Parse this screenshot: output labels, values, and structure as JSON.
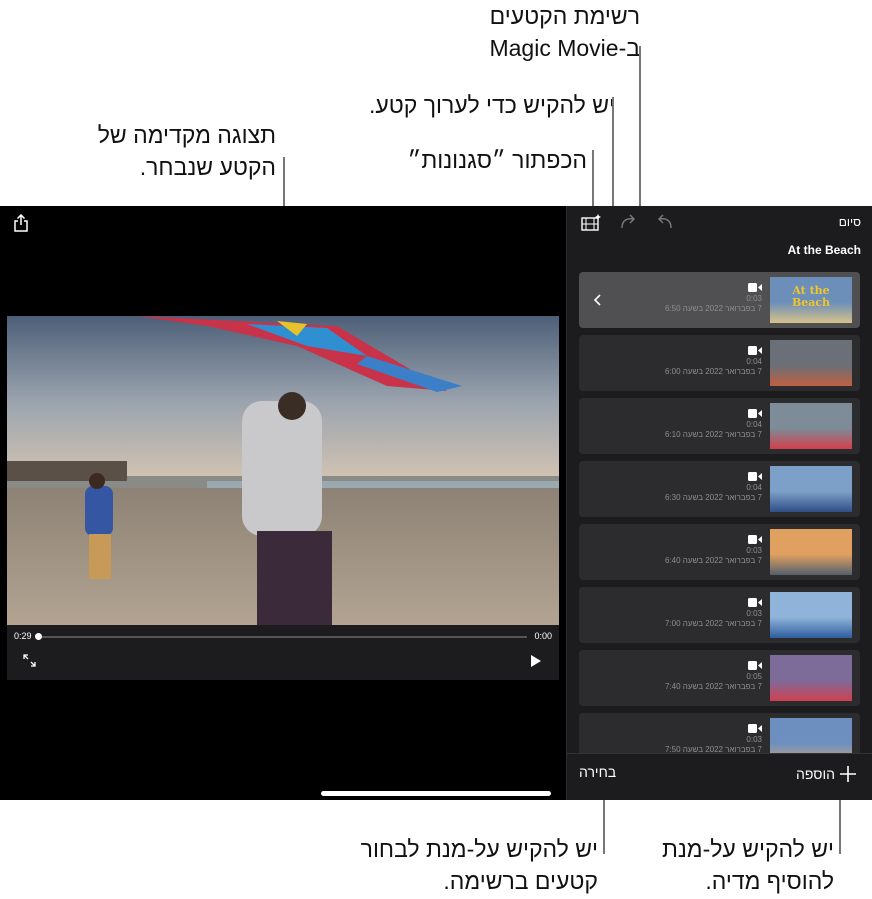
{
  "callouts": {
    "clip_list": [
      "רשימת הקטעים",
      "ב-Magic Movie"
    ],
    "edit_clip": "יש להקיש כדי לערוך קטע.",
    "styles_button": "הכפתור ״סגנונות״",
    "preview": [
      "תצוגה מקדימה של",
      "הקטע שנבחר."
    ],
    "select_clips": [
      "יש להקיש על-מנת לבחור",
      "קטעים ברשימה."
    ],
    "add_media": [
      "יש להקיש על-מנת",
      "להוסיף מדיה."
    ]
  },
  "sidebar": {
    "done_label": "סיום",
    "project_title": "At the Beach",
    "clips": [
      {
        "duration": "0:03",
        "date": "7 בפברואר 2022 בשעה 6:50",
        "selected": true,
        "thumb_title": "At the Beach"
      },
      {
        "duration": "0:04",
        "date": "7 בפברואר 2022 בשעה 6:00",
        "selected": false
      },
      {
        "duration": "0:04",
        "date": "7 בפברואר 2022 בשעה 6:10",
        "selected": false
      },
      {
        "duration": "0:04",
        "date": "7 בפברואר 2022 בשעה 6:30",
        "selected": false
      },
      {
        "duration": "0:03",
        "date": "7 בפברואר 2022 בשעה 6:40",
        "selected": false
      },
      {
        "duration": "0:03",
        "date": "7 בפברואר 2022 בשעה 7:00",
        "selected": false
      },
      {
        "duration": "0:05",
        "date": "7 בפברואר 2022 בשעה 7:40",
        "selected": false
      },
      {
        "duration": "0:03",
        "date": "7 בפברואר 2022 בשעה 7:50",
        "selected": false
      }
    ],
    "add_label": "הוספה",
    "select_label": "בחירה"
  },
  "player": {
    "elapsed": "0:29",
    "current": "0:00",
    "progress": 0.0
  },
  "icons": [
    "share-icon",
    "styles-icon",
    "redo-icon",
    "undo-icon",
    "fullscreen-icon",
    "play-icon",
    "video-camera-icon",
    "chevron-left-icon",
    "plus-icon"
  ],
  "colors": {
    "screen_bg": "#000000",
    "sidebar_bg": "#1c1c1e",
    "card_bg": "#2c2c2e",
    "card_selected": "#505052"
  }
}
